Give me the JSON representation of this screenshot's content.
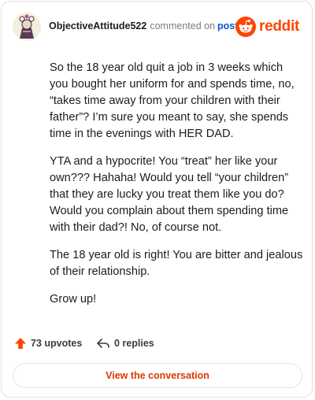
{
  "comment": {
    "username": "ObjectiveAttitude522",
    "action_text": "commented on",
    "post_link_label": "post",
    "paragraphs": [
      "So the 18 year old quit a job in 3 weeks which you bought her uniform for and spends time, no, “takes time away from your children with their father”? I’m sure you meant to say, she spends time in the evenings with HER DAD.",
      "YTA and a hypocrite! You “treat” her like your own??? Hahaha! Would you tell “your children” that they are lucky you treat them like you do? Would you complain about them spending time with their dad?! No, of course not.",
      "The 18 year old is right! You are bitter and jealous of their relationship.",
      "Grow up!"
    ],
    "upvotes_label": "73 upvotes",
    "replies_label": "0 replies"
  },
  "brand": {
    "wordmark": "reddit",
    "color": "#ff4500",
    "icon": "reddit-alien-icon"
  },
  "cta": {
    "label": "View the conversation"
  },
  "colors": {
    "accent": "#ff4500",
    "link": "#0a58ca",
    "cta_text": "#d93a00",
    "border": "#dfe1e3"
  }
}
